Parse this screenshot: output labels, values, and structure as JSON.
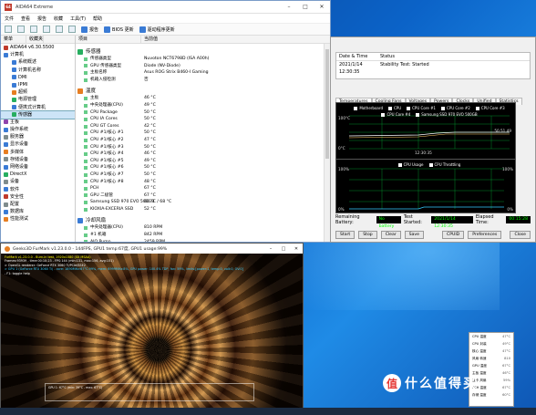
{
  "aida": {
    "title": "AIDA64 Extreme",
    "menu": [
      "文件",
      "查看",
      "报告",
      "收藏",
      "工具(T)",
      "帮助"
    ],
    "toolbar": {
      "report": "报告",
      "bios": "BIOS 更新",
      "driver": "驱动程序更新"
    },
    "left_headers": [
      "菜单",
      "收藏夹"
    ],
    "tree": [
      {
        "label": "AIDA64 v6.30.5500",
        "color": "#c0392b"
      },
      {
        "label": "计算机",
        "color": "#3a7bd5"
      },
      {
        "label": "系统概述",
        "color": "#3a7bd5"
      },
      {
        "label": "计算机名称",
        "color": "#3a7bd5"
      },
      {
        "label": "DMI",
        "color": "#3a7bd5"
      },
      {
        "label": "IPMI",
        "color": "#3a7bd5"
      },
      {
        "label": "超频",
        "color": "#e67e22"
      },
      {
        "label": "电源管理",
        "color": "#27ae60"
      },
      {
        "label": "便携式计算机",
        "color": "#3a7bd5"
      },
      {
        "label": "传感器",
        "color": "#27ae60",
        "selected": true
      },
      {
        "label": "主板",
        "color": "#8e44ad"
      },
      {
        "label": "操作系统",
        "color": "#3a7bd5"
      },
      {
        "label": "服务器",
        "color": "#7f8c8d"
      },
      {
        "label": "显示设备",
        "color": "#3a7bd5"
      },
      {
        "label": "多媒体",
        "color": "#e67e22"
      },
      {
        "label": "存储设备",
        "color": "#7f8c8d"
      },
      {
        "label": "网络设备",
        "color": "#3a7bd5"
      },
      {
        "label": "DirectX",
        "color": "#27ae60"
      },
      {
        "label": "设备",
        "color": "#7f8c8d"
      },
      {
        "label": "软件",
        "color": "#3a7bd5"
      },
      {
        "label": "安全性",
        "color": "#c0392b"
      },
      {
        "label": "配置",
        "color": "#7f8c8d"
      },
      {
        "label": "数据库",
        "color": "#3a7bd5"
      },
      {
        "label": "性能测试",
        "color": "#e67e22"
      }
    ],
    "right_headers": [
      "项目",
      "当前值"
    ],
    "sections": [
      {
        "title": "传感器",
        "color": "#27ae60",
        "rows": [
          {
            "k": "传感器类型",
            "v": "Nuvoton NCT6798D  (ISA A00h)"
          },
          {
            "k": "GPU 传感器类型",
            "v": "Diode  (NV-Diode)"
          },
          {
            "k": "主板名称",
            "v": "Asus ROG Strix B460-I Gaming"
          },
          {
            "k": "机箱入侵检测",
            "v": "否"
          }
        ]
      },
      {
        "title": "温度",
        "color": "#e67e22",
        "rows": [
          {
            "k": "主板",
            "v": "46 °C"
          },
          {
            "k": "中央处理器(CPU)",
            "v": "49 °C"
          },
          {
            "k": "CPU Package",
            "v": "50 °C"
          },
          {
            "k": "CPU IA Cores",
            "v": "50 °C"
          },
          {
            "k": "CPU GT Cores",
            "v": "42 °C"
          },
          {
            "k": "CPU #1/核心 #1",
            "v": "50 °C"
          },
          {
            "k": "CPU #1/核心 #2",
            "v": "47 °C"
          },
          {
            "k": "CPU #1/核心 #3",
            "v": "50 °C"
          },
          {
            "k": "CPU #1/核心 #4",
            "v": "46 °C"
          },
          {
            "k": "CPU #1/核心 #5",
            "v": "49 °C"
          },
          {
            "k": "CPU #1/核心 #6",
            "v": "50 °C"
          },
          {
            "k": "CPU #1/核心 #7",
            "v": "50 °C"
          },
          {
            "k": "CPU #1/核心 #8",
            "v": "48 °C"
          },
          {
            "k": "PCH",
            "v": "67 °C"
          },
          {
            "k": "GPU 二极管",
            "v": "67 °C"
          },
          {
            "k": "Samsung SSD 970 EVO 500GB",
            "v": "60 °C / 68 °C"
          },
          {
            "k": "KIOXIA-EXCERIA SSD",
            "v": "52 °C"
          }
        ]
      },
      {
        "title": "冷却风扇",
        "color": "#3a7bd5",
        "rows": [
          {
            "k": "中央处理器(CPU)",
            "v": "810 RPM"
          },
          {
            "k": "#1 机箱",
            "v": "842 RPM"
          },
          {
            "k": "AIO Pump",
            "v": "2459 RPM"
          }
        ]
      }
    ]
  },
  "stability": {
    "table_headers": [
      "Date & Time",
      "Status"
    ],
    "table_row": [
      "2021/1/14 12:30:35",
      "Stability Test: Started"
    ],
    "tabs": [
      "Temperatures",
      "Cooling Fans",
      "Voltages",
      "Powers",
      "Clocks",
      "Unified",
      "Statistics"
    ],
    "active_tab": "Temperatures",
    "legend1": [
      "Motherboard",
      "CPU",
      "CPU Core #1",
      "CPU Core #2",
      "CPU Core #3",
      "CPU Core #4",
      "Samsung SSD 970 EVO 500GB"
    ],
    "g1_top": "100°C",
    "g1_bottom": "0°C",
    "g1_time": "12:30:35",
    "g1_readout": "50 51 49",
    "legend2": [
      "CPU Usage",
      "CPU Throttling"
    ],
    "g2_top": "100%",
    "g2_bottom": "0%",
    "g2_right_top": "100%",
    "g2_right_bottom": "0%",
    "remaining_label": "Remaining Battery:",
    "remaining_value": "No battery",
    "started_label": "Test Started:",
    "started_value": "2021/1/14 12:30:35",
    "elapsed_label": "Elapsed Time:",
    "elapsed_value": "00:15:28",
    "buttons": [
      "Start",
      "Stop",
      "Clear",
      "Save",
      "CPUID",
      "Preferences",
      "Close"
    ]
  },
  "furmark": {
    "title": "Geeks3D FurMark v1.23.0.0 - 144FPS, GPU1 temp:67度, GPU1 usage:99%",
    "info": [
      "FurMark v1.23.0.0 - Burn-in test, 1920x1080 (0X MSAA)",
      "Frames:93939 - time:00:10:23 - FPS:144 (min:131, max:156, avg:151)",
      "> OpenGL renderer: GeForce RTX 3060 Ti/PCIe/SSE2",
      "> GPU 1 (GeForce RTX 3060 Ti) - core: 1890MHz:67°C:99%, mem: 6999MHz:8%, GPU power: 100.4% TDP, fan: 59%, limits:[power:1, temp:0, volt:0, OV:0]",
      "- F1: toggle help"
    ],
    "temp_label": "GPU 1: 67°C (min: 39°C - max: 67°C)"
  },
  "sensor_popup": [
    {
      "k": "CPU 温度",
      "v": "47°C"
    },
    {
      "k": "CPU 封装",
      "v": "49°C"
    },
    {
      "k": "核心 温度",
      "v": "47°C"
    },
    {
      "k": "风扇 转速",
      "v": "810"
    },
    {
      "k": "GPU 温度",
      "v": "67°C"
    },
    {
      "k": "主板 温度",
      "v": "46°C"
    },
    {
      "k": "显卡 风扇",
      "v": "59%"
    },
    {
      "k": "PCH 温度",
      "v": "67°C"
    },
    {
      "k": "存储 温度",
      "v": "60°C"
    }
  ],
  "watermark": {
    "text": "什么值得买",
    "icon": "值"
  }
}
